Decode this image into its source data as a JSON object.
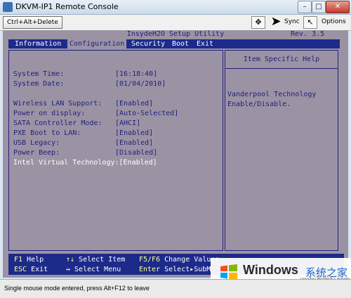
{
  "window": {
    "title": "DKVM-IP1 Remote Console",
    "minimize": "–",
    "maximize": "□",
    "close": "✕"
  },
  "toolbar": {
    "ctrl_alt_delete": "Ctrl+Alt+Delete",
    "fullscreen_icon": "✥",
    "cursor_icon": "➤",
    "sync": "Sync",
    "mouse_icon": "↖",
    "options": "Options"
  },
  "bios": {
    "title": "InsydeH2O Setup Utility",
    "revision": "Rev. 3.5",
    "menu": [
      "Information",
      "Configuration",
      "Security",
      "Boot",
      "Exit"
    ],
    "active_menu": "Configuration",
    "settings": [
      {
        "label": "System Time:",
        "value": "[16:18:40]"
      },
      {
        "label": "System Date:",
        "value": "[01/04/2010]"
      },
      {
        "label": "Wireless LAN Support:",
        "value": "[Enabled]"
      },
      {
        "label": "Power on display:",
        "value": "[Auto-Selected]"
      },
      {
        "label": "SATA Controller Mode:",
        "value": "[AHCI]"
      },
      {
        "label": "PXE Boot to LAN:",
        "value": "[Enabled]"
      },
      {
        "label": "USB Legacy:",
        "value": "[Enabled]"
      },
      {
        "label": "Power Beep:",
        "value": "[Disabled]"
      },
      {
        "label": "Intel Virtual Technology:",
        "value": "[Enabled]"
      }
    ],
    "help": {
      "title": "Item Specific Help",
      "line1": "Vanderpool Technology",
      "line2": "Enable/Disable."
    },
    "footer": [
      {
        "key": "F1",
        "label": "Help"
      },
      {
        "key": "↑↓",
        "label": "Select Item"
      },
      {
        "key": "F5/F6",
        "label": "Change Values"
      },
      {
        "key": "ESC",
        "label": "Exit"
      },
      {
        "key": "↔",
        "label": "Select Menu"
      },
      {
        "key": "Enter",
        "label": "Select▸SubM"
      }
    ]
  },
  "watermark": {
    "brand": "Windows",
    "cn": "系统之家",
    "url": "www.bjjmlv.com"
  },
  "status": {
    "text": "Single mouse mode entered, press Alt+F12 to leave"
  }
}
